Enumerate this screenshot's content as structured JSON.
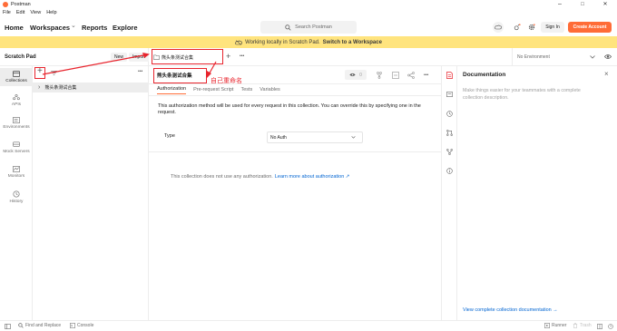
{
  "window": {
    "title": "Postman",
    "controls": [
      "–",
      "□",
      "✕"
    ]
  },
  "menu": [
    "File",
    "Edit",
    "View",
    "Help"
  ],
  "header": {
    "nav": [
      "Home",
      "Workspaces",
      "Reports",
      "Explore"
    ],
    "workspaces_caret": "⌄",
    "search_placeholder": "Search Postman",
    "sign_in": "Sign In",
    "create_account": "Create Account"
  },
  "banner": {
    "text": "Working locally in Scratch Pad.",
    "link": "Switch to a Workspace"
  },
  "workspace": {
    "name": "Scratch Pad",
    "new": "New",
    "import": "Import"
  },
  "left_nav": [
    {
      "label": "Collections",
      "icon": "collections-icon"
    },
    {
      "label": "APIs",
      "icon": "apis-icon"
    },
    {
      "label": "Environments",
      "icon": "environments-icon"
    },
    {
      "label": "Mock Servers",
      "icon": "mock-servers-icon"
    },
    {
      "label": "Monitors",
      "icon": "monitors-icon"
    },
    {
      "label": "History",
      "icon": "history-icon"
    }
  ],
  "collection_panel": {
    "add": "+",
    "more": "•••",
    "item": "熊头条测试合集",
    "item_caret": "›"
  },
  "tab": {
    "label": "熊头条测试合集",
    "add": "+",
    "more": "•••"
  },
  "environment": {
    "label": "No Environment"
  },
  "request": {
    "name": "熊头条测试合集",
    "watch_count": "0",
    "subtabs": [
      "Authorization",
      "Pre-request Script",
      "Tests",
      "Variables"
    ],
    "auth_info": "This authorization method will be used for every request in this collection. You can override this by specifying one in the request.",
    "type_label": "Type",
    "type_value": "No Auth",
    "no_auth_text": "This collection does not use any authorization.",
    "learn_more": "Learn more about authorization ↗"
  },
  "annotation": {
    "text": "自己重命名"
  },
  "doc": {
    "title": "Documentation",
    "description": "Make things easier for your teammates with a complete collection description.",
    "link": "View complete collection documentation →"
  },
  "status": {
    "find_replace": "Find and Replace",
    "console": "Console",
    "runner": "Runner",
    "trash": "Trash"
  },
  "colors": {
    "accent": "#ff6c37",
    "banner": "#ffe47e",
    "annotation": "#e8242d"
  }
}
